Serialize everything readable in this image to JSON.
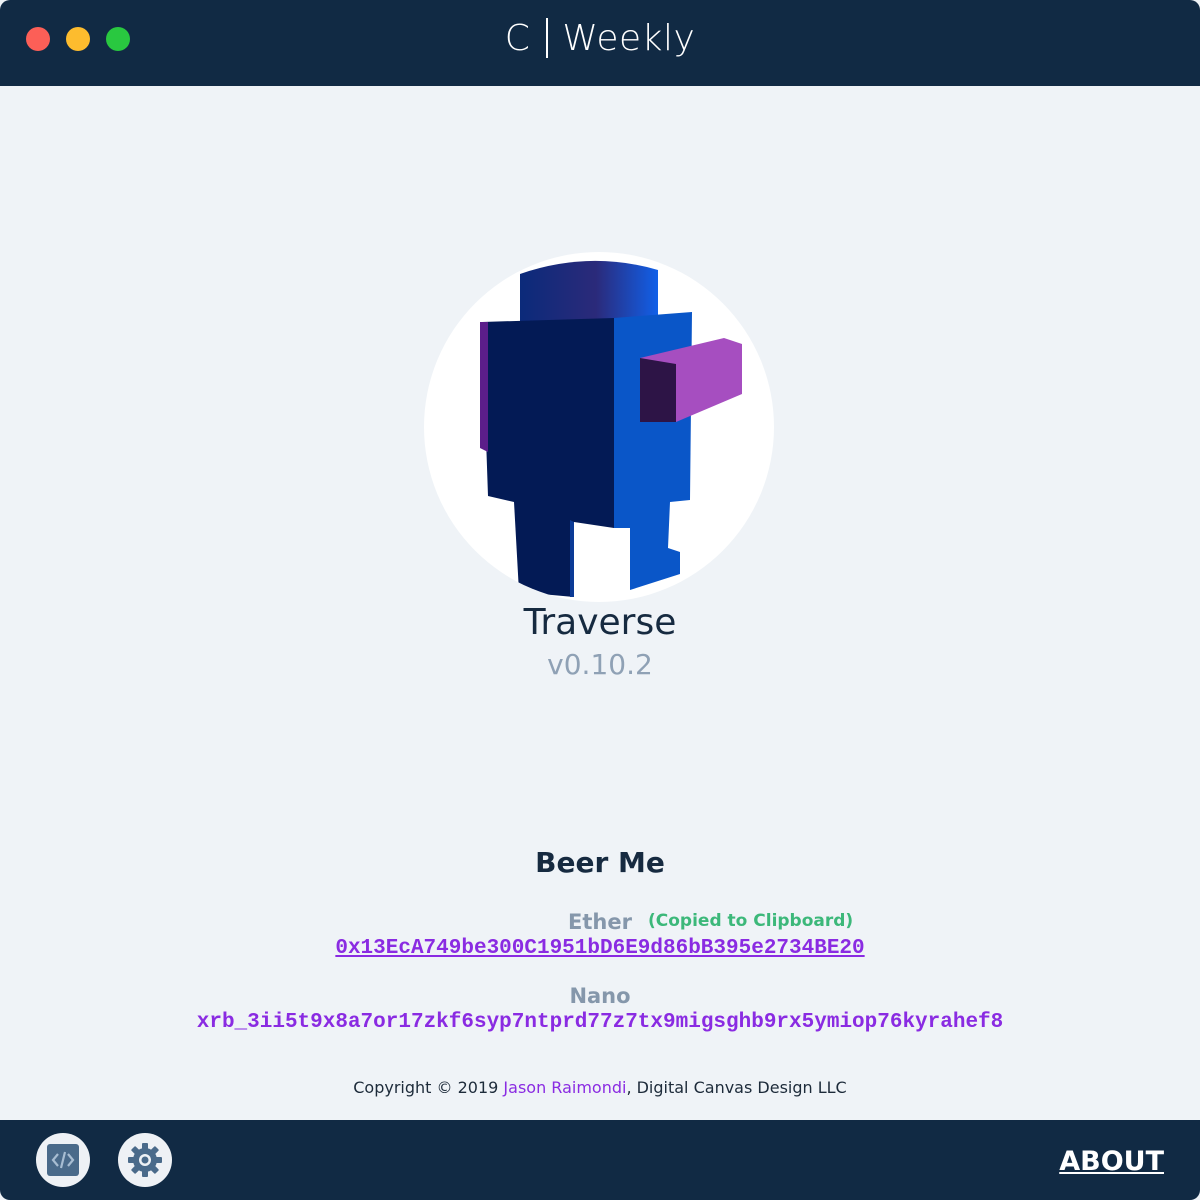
{
  "window": {
    "title_prefix": "C",
    "title_suffix": "Weekly",
    "controls": [
      "close",
      "minimize",
      "maximize"
    ]
  },
  "product": {
    "logo_icon": "blue-voxel-robot-logo",
    "name": "Traverse",
    "version": "v0.10.2"
  },
  "donate": {
    "heading": "Beer Me",
    "ether": {
      "label": "Ether",
      "status": "(Copied to Clipboard)",
      "address": "0x13EcA749be300C1951bD6E9d86bB395e2734BE20"
    },
    "nano": {
      "label": "Nano",
      "address": "xrb_3ii5t9x8a7or17zkf6syp7ntprd77z7tx9migsghb9rx5ymiop76kyrahef8"
    }
  },
  "copyright": {
    "prefix": "Copyright © 2019",
    "author": "Jason Raimondi",
    "company": "Digital Canvas Design LLC"
  },
  "footer": {
    "dev_tools_icon": "code-icon",
    "settings_icon": "gear-icon",
    "about_label": "ABOUT"
  },
  "colors": {
    "chrome": "#112a44",
    "background": "#eff3f7",
    "accent": "#8a2be2",
    "success": "#3cb87a",
    "muted": "#8597ab"
  }
}
